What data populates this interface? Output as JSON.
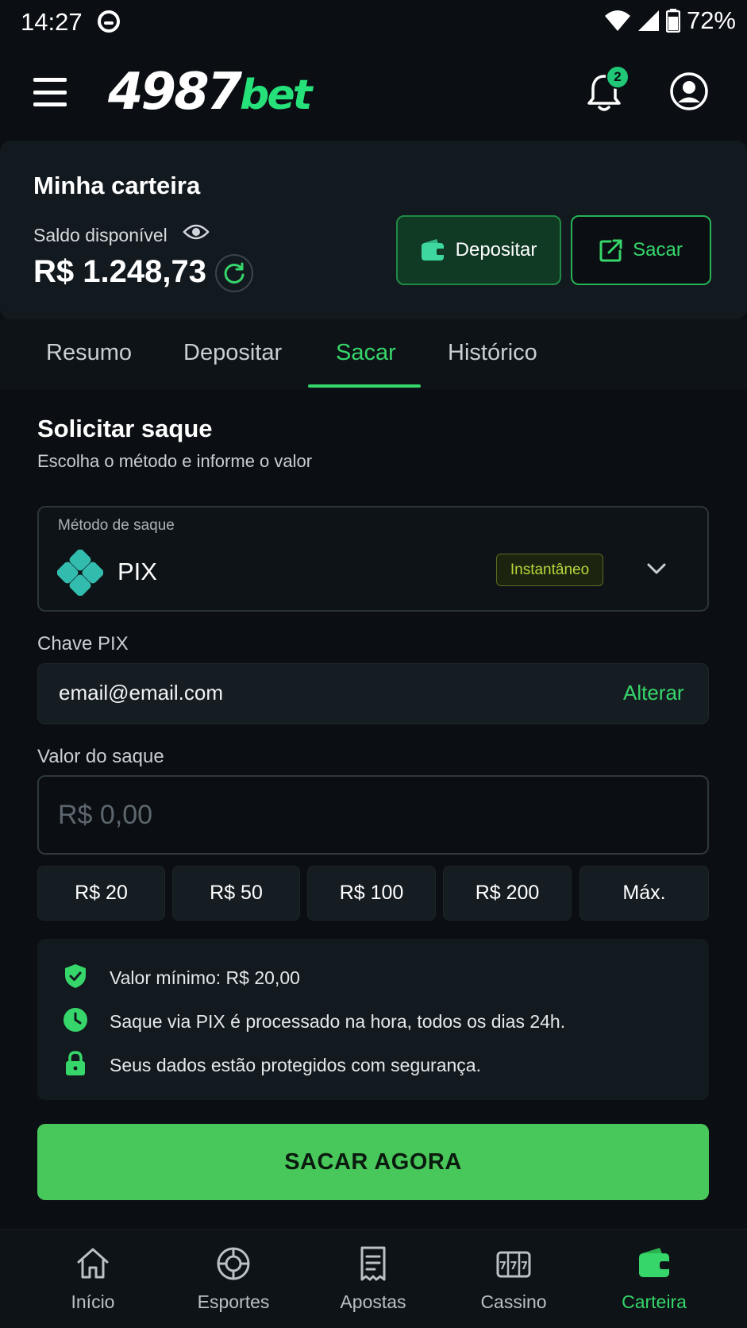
{
  "status_bar": {
    "time": "14:27",
    "battery": "72%"
  },
  "header": {
    "logo_number": "4987",
    "logo_suffix": "bet",
    "notification_count": "2"
  },
  "wallet": {
    "title": "Minha carteira",
    "balance_label": "Saldo disponível",
    "balance_value": "R$ 1.248,73",
    "deposit_label": "Depositar",
    "withdraw_label": "Sacar"
  },
  "tabs": [
    {
      "label": "Resumo"
    },
    {
      "label": "Depositar"
    },
    {
      "label": "Sacar",
      "active": true
    },
    {
      "label": "Histórico"
    }
  ],
  "form": {
    "title": "Solicitar saque",
    "subtitle": "Escolha o método e informe o valor",
    "method_label": "Método de saque",
    "method_name": "PIX",
    "method_badge": "Instantâneo",
    "pix_key_label": "Chave PIX",
    "pix_key_value": "email@email.com",
    "pix_key_change": "Alterar",
    "amount_label": "Valor do saque",
    "amount_placeholder": "R$ 0,00",
    "quick_amounts": [
      "R$ 20",
      "R$ 50",
      "R$ 100",
      "R$ 200",
      "Máx."
    ],
    "info": [
      {
        "icon": "shield-check-icon",
        "text": "Valor mínimo: R$ 20,00"
      },
      {
        "icon": "clock-icon",
        "text": "Saque via PIX é processado na hora, todos os dias 24h."
      },
      {
        "icon": "lock-icon",
        "text": "Seus dados estão protegidos com segurança."
      }
    ],
    "submit_label": "SACAR AGORA"
  },
  "bottom_nav": [
    {
      "label": "Início",
      "icon": "home-icon"
    },
    {
      "label": "Esportes",
      "icon": "sports-ball-icon"
    },
    {
      "label": "Apostas",
      "icon": "bet-slip-icon"
    },
    {
      "label": "Cassino",
      "icon": "slot-machine-icon"
    },
    {
      "label": "Carteira",
      "icon": "wallet-icon",
      "active": true
    }
  ],
  "colors": {
    "accent": "#36d66a",
    "background": "#0b0f13",
    "card": "#131a1f",
    "cta": "#48c75a"
  }
}
